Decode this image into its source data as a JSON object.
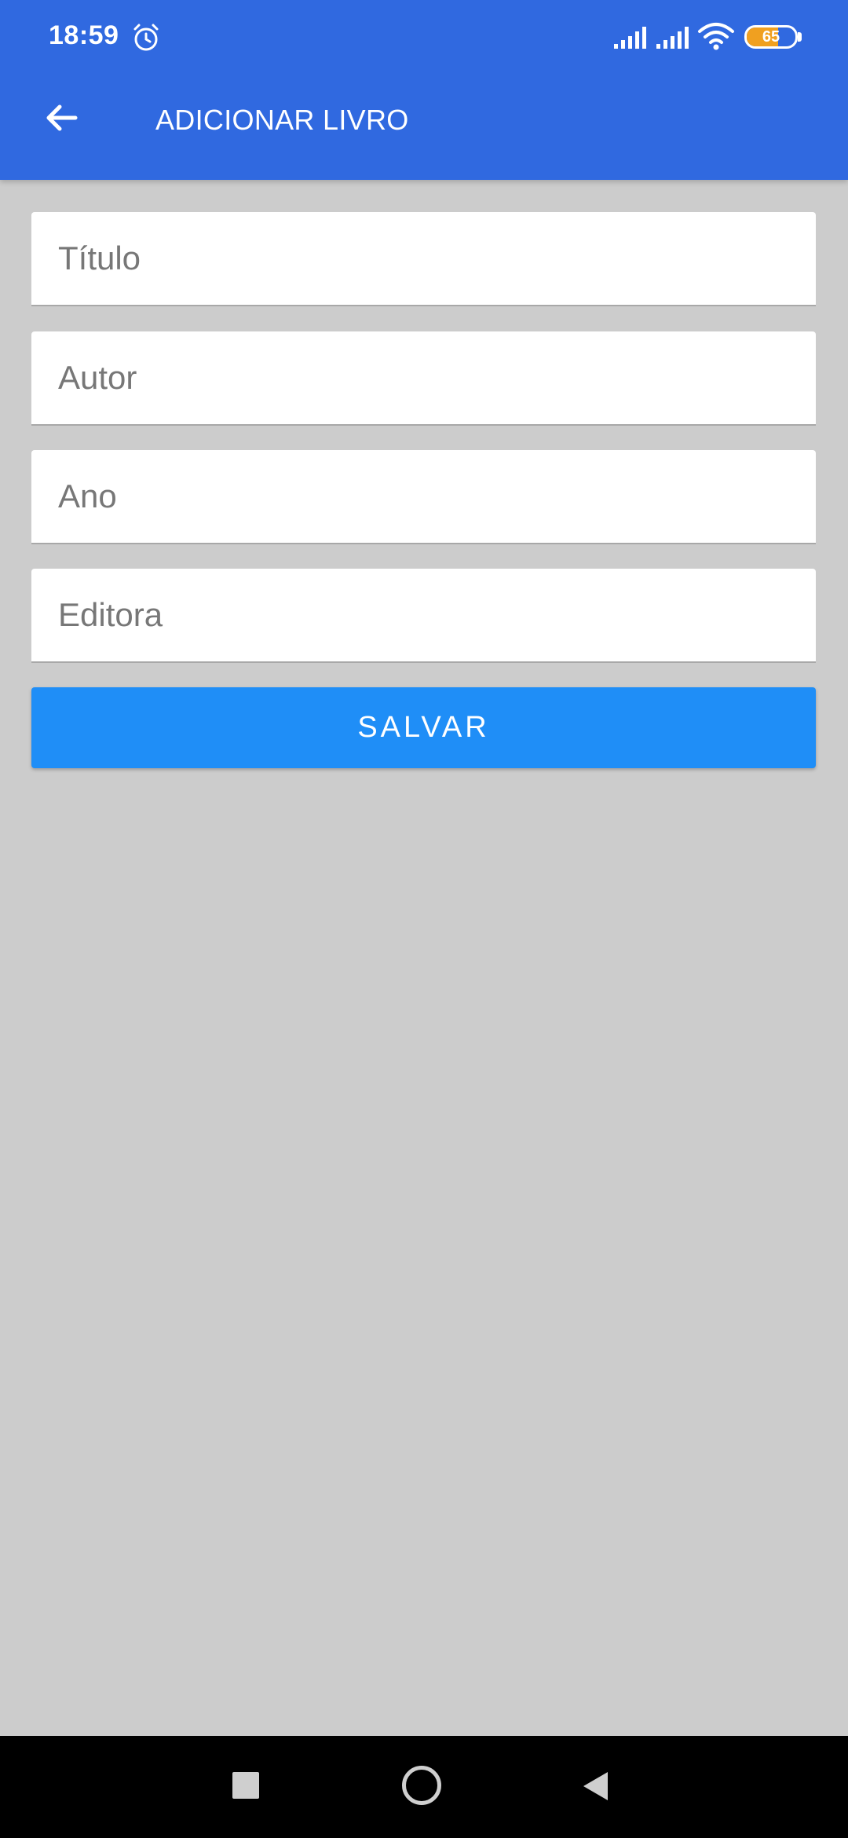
{
  "status_bar": {
    "time": "18:59",
    "battery_level": "65",
    "battery_fraction": 0.65,
    "icons": [
      "alarm-icon",
      "signal-icon",
      "signal-icon",
      "wifi-icon",
      "battery-icon"
    ]
  },
  "app_bar": {
    "title": "ADICIONAR LIVRO",
    "back_icon": "arrow-back-icon",
    "color": "#3069e0"
  },
  "form": {
    "fields": [
      {
        "placeholder": "Título",
        "value": ""
      },
      {
        "placeholder": "Autor",
        "value": ""
      },
      {
        "placeholder": "Ano",
        "value": ""
      },
      {
        "placeholder": "Editora",
        "value": ""
      }
    ],
    "save_label": "SALVAR",
    "save_color": "#1f8ef7"
  },
  "nav_bar": {
    "buttons": [
      "recents-icon",
      "home-icon",
      "back-icon"
    ]
  },
  "colors": {
    "background": "#cccccc",
    "battery_accent": "#f0a020"
  }
}
